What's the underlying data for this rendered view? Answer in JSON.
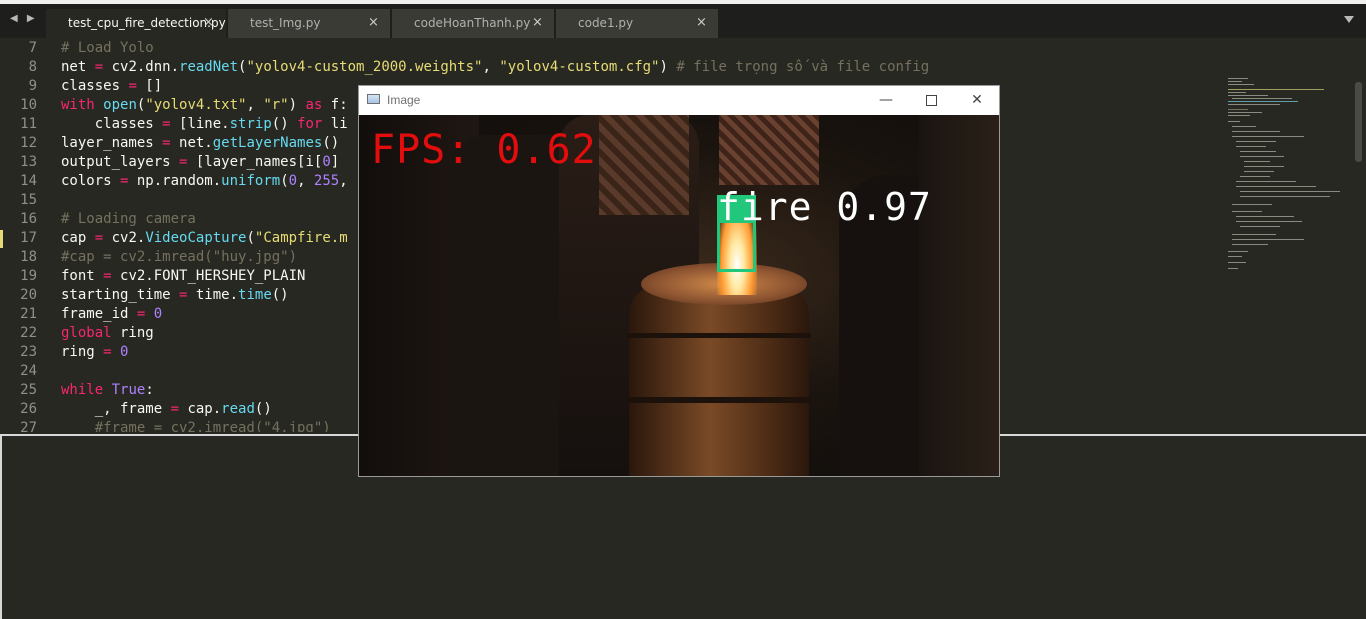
{
  "tabs": [
    {
      "label": "test_cpu_fire_detection.py",
      "close": "×"
    },
    {
      "label": "test_Img.py",
      "close": "×"
    },
    {
      "label": "codeHoanThanh.py",
      "close": "×"
    },
    {
      "label": "code1.py",
      "close": "×"
    }
  ],
  "nav_arrows": "◀ ▶",
  "editor": {
    "line_numbers": [
      "7",
      "8",
      "9",
      "10",
      "11",
      "12",
      "13",
      "14",
      "15",
      "16",
      "17",
      "18",
      "19",
      "20",
      "21",
      "22",
      "23",
      "24",
      "25",
      "26",
      "27"
    ],
    "current_line": "17"
  },
  "image_window": {
    "title": "Image",
    "minimize": "—",
    "close": "✕",
    "fps_text": "FPS: 0.62",
    "detection_label": "fire 0.97"
  },
  "colors": {
    "editor_bg": "#272822",
    "keyword": "#f92672",
    "function": "#66d9ef",
    "string": "#e6db74",
    "comment": "#75715e",
    "number": "#ae81ff",
    "fps_text": "#e30d0d",
    "detection_box": "#21c77a"
  }
}
